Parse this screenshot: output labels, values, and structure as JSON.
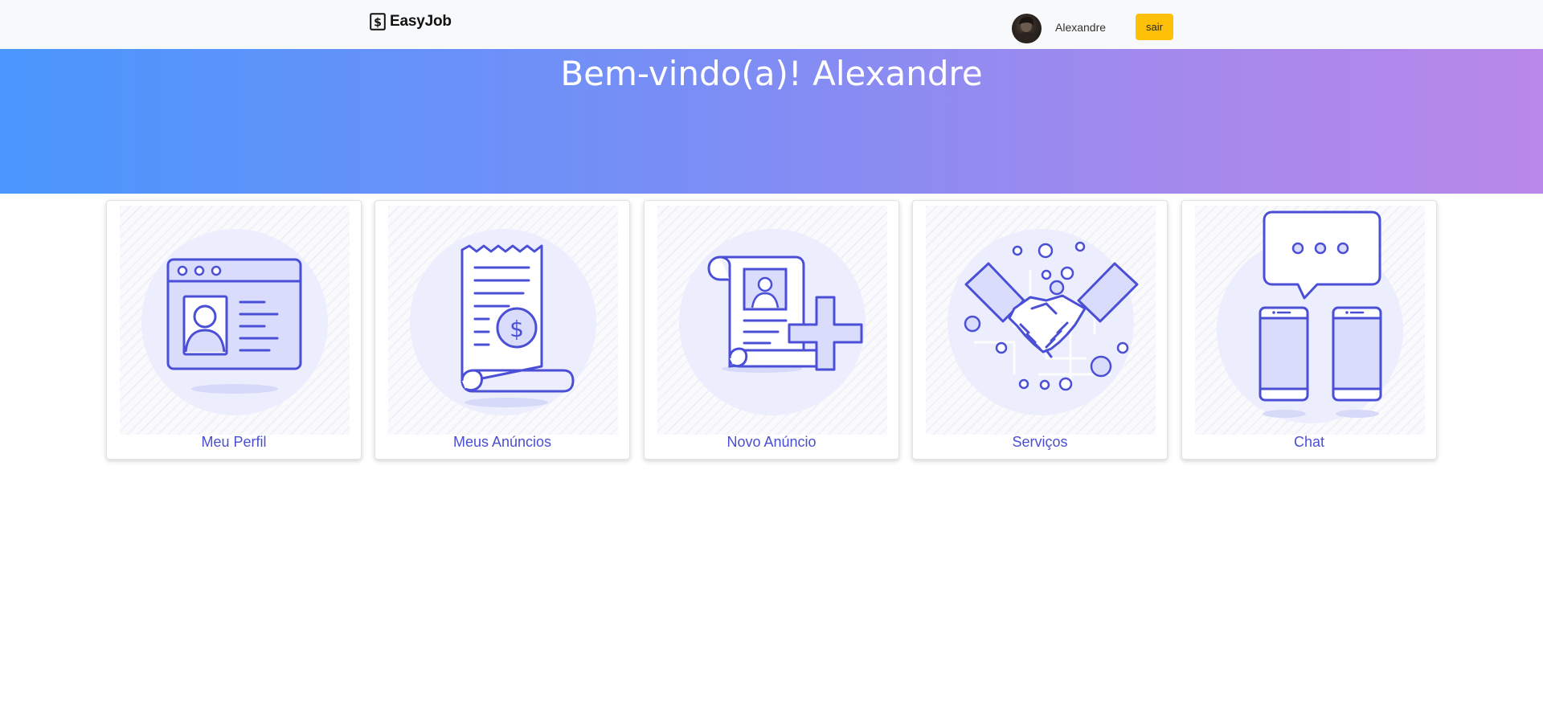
{
  "navbar": {
    "brand": "EasyJob",
    "brand_icon": "dollar-square-icon",
    "username": "Alexandre",
    "logout_label": "sair"
  },
  "hero": {
    "title": "Bem-vindo(a)! Alexandre"
  },
  "cards": [
    {
      "label": "Meu Perfil",
      "icon": "profile-card-icon"
    },
    {
      "label": "Meus Anúncios",
      "icon": "receipt-dollar-icon"
    },
    {
      "label": "Novo Anúncio",
      "icon": "new-document-plus-icon"
    },
    {
      "label": "Serviços",
      "icon": "handshake-icon"
    },
    {
      "label": "Chat",
      "icon": "chat-phones-icon"
    }
  ],
  "colors": {
    "navbar_bg": "#f8f9fa",
    "logout_button": "#ffc107",
    "hero_gradient_start": "#4a97fd",
    "hero_gradient_end": "#b888ea",
    "accent": "#4a4fd1",
    "illustration_fill": "#d9dcfa"
  }
}
